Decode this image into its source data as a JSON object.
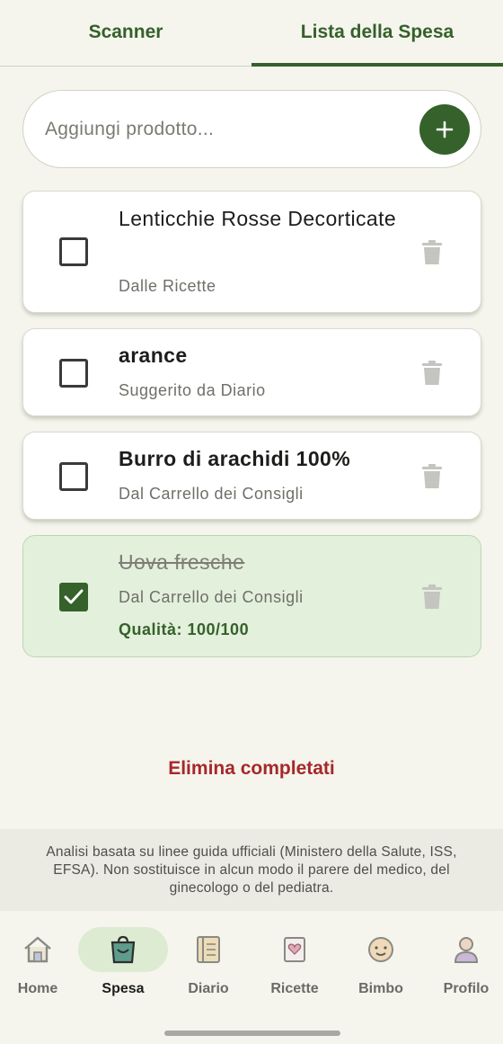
{
  "tabs": [
    {
      "label": "Scanner",
      "active": false
    },
    {
      "label": "Lista della Spesa",
      "active": true
    }
  ],
  "add_bar": {
    "placeholder": "Aggiungi prodotto..."
  },
  "items": [
    {
      "name": "Lenticchie Rosse Decorticate",
      "source": "Dalle Ricette",
      "checked": false
    },
    {
      "name": "arance",
      "source": "Suggerito da Diario",
      "checked": false
    },
    {
      "name": "Burro di arachidi 100%",
      "source": "Dal Carrello dei Consigli",
      "checked": false
    },
    {
      "name": "Uova fresche",
      "source": "Dal Carrello dei Consigli",
      "quality": "Qualità: 100/100",
      "checked": true
    }
  ],
  "clear_completed_label": "Elimina completati",
  "disclaimer": "Analisi basata su linee guida ufficiali (Ministero della Salute, ISS, EFSA). Non sostituisce in alcun modo il parere del medico, del ginecologo o del pediatra.",
  "nav": [
    {
      "label": "Home",
      "icon": "home-icon",
      "active": false
    },
    {
      "label": "Spesa",
      "icon": "shopping-bag-icon",
      "active": true
    },
    {
      "label": "Diario",
      "icon": "journal-icon",
      "active": false
    },
    {
      "label": "Ricette",
      "icon": "recipe-card-icon",
      "active": false
    },
    {
      "label": "Bimbo",
      "icon": "baby-face-icon",
      "active": false
    },
    {
      "label": "Profilo",
      "icon": "person-icon",
      "active": false
    }
  ],
  "colors": {
    "primary": "#35612a",
    "danger": "#a72828",
    "completed_card_bg": "#e3f0dc",
    "background": "#f5f5ee"
  }
}
